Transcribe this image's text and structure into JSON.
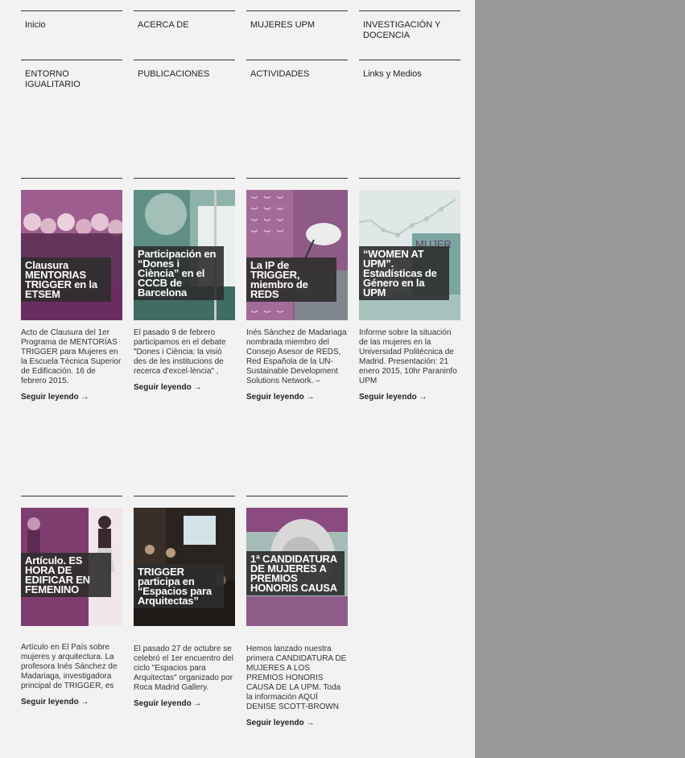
{
  "nav": {
    "items": [
      {
        "label": "Inicio"
      },
      {
        "label": "ACERCA DE"
      },
      {
        "label": "MUJERES UPM"
      },
      {
        "label": "INVESTIGACIÓN Y DOCENCIA"
      },
      {
        "label": "ENTORNO IGUALITARIO"
      },
      {
        "label": "PUBLICACIONES"
      },
      {
        "label": "ACTIVIDADES"
      },
      {
        "label": "Links y Medios"
      }
    ]
  },
  "posts": [
    {
      "title": "Clausura MENTORIAS TRIGGER en la ETSEM",
      "excerpt": "Acto de Clausura del 1er Programa de MENTORÍAS TRIGGER para Mujeres en la Escuela Técnica Superior de Edificación. 16 de febrero 2015.",
      "more": "Seguir leyendo →",
      "thumb_icon": "group-photo-icon",
      "tint": "#8a3a7a"
    },
    {
      "title": "Participación en “Dones i Ciència” en el CCCB de Barcelona",
      "excerpt": "El pasado 9 de febrero participamos en el debate \"Dones i Ciència: la visió des de les institucions de recerca d'excel·lència\" ,",
      "more": "Seguir leyendo →",
      "thumb_icon": "building-photo-icon",
      "tint": "#5f8f84"
    },
    {
      "title": "La IP de TRIGGER, miembro de REDS",
      "excerpt": "Inés Sánchez de Madariaga nombrada miembro del Consejo Asesor de REDS, Red Española de la UN-Sustainable Development Solutions Network. –",
      "more": "Seguir leyendo →",
      "thumb_icon": "pattern-photo-icon",
      "tint": "#8e5a86"
    },
    {
      "title": "“WOMEN AT UPM”. Estadísticas de Género en la UPM",
      "excerpt": "Informe sobre la situación de las mujeres en la Universidad Politécnica de Madrid. Presentación: 21 enero 2015, 10hr Paraninfo UPM",
      "more": "Seguir leyendo →",
      "thumb_icon": "chart-photo-icon",
      "tint": "#7aa5a0",
      "thumb_text": "MUJER"
    },
    {
      "title": "Artículo. ES HORA DE EDIFICAR EN FEMENINO",
      "excerpt": "  Artículo en El País sobre mujeres y arquitectura. La profesora Inés Sánchez de Madariaga, investigadora principal de TRIGGER, es",
      "more": "Seguir leyendo →",
      "thumb_icon": "women-photo-icon",
      "tint": "#7e3d6f"
    },
    {
      "title": "TRIGGER participa en “Espacios para Arquitectas”",
      "excerpt": "El pasado 27 de octubre se celebró el 1er encuentro del ciclo \"Espacios para Arquitectas\" organizado por Roca Madrid Gallery.",
      "more": "Seguir leyendo →",
      "thumb_icon": "event-photo-icon",
      "tint": "#2a2420"
    },
    {
      "title": "1ª CANDIDATURA DE MUJERES A PREMIOS HONORIS CAUSA",
      "excerpt": "Hemos lanzado nuestra primera CANDIDATURA DE MUJERES A LOS PREMIOS HONORIS CAUSA DE LA UPM. Toda la información AQUÍ DENISE SCOTT-BROWN",
      "more": "Seguir leyendo →",
      "thumb_icon": "portrait-photo-icon",
      "tint": "#8b4a80"
    }
  ]
}
